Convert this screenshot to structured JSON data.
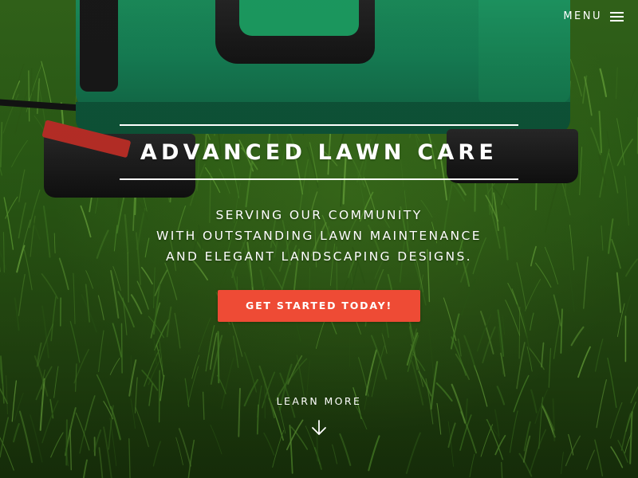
{
  "nav": {
    "menu_label": "MENU",
    "menu_icon": "hamburger-icon"
  },
  "hero": {
    "title": "ADVANCED LAWN CARE",
    "tagline": [
      "SERVING OUR COMMUNITY",
      "WITH OUTSTANDING LAWN MAINTENANCE",
      "AND ELEGANT LANDSCAPING DESIGNS."
    ],
    "cta_label": "GET STARTED TODAY!",
    "learn_more_label": "LEARN MORE",
    "learn_more_icon": "arrow-down-icon"
  },
  "colors": {
    "accent": "#ee4b35",
    "text": "#ffffff",
    "mower_green": "#1f9a63",
    "grass_green": "#2d6116"
  }
}
